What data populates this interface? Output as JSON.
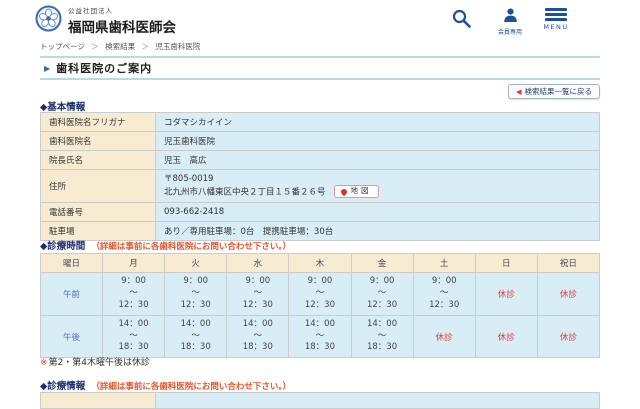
{
  "header": {
    "org_type": "公益社団法人",
    "org_name": "福岡県歯科医師会",
    "member_label": "会員専用",
    "menu_label": "MENU"
  },
  "breadcrumb": {
    "items": [
      "トップページ",
      "検索結果",
      "児玉歯科医院"
    ],
    "separator": "＞"
  },
  "page": {
    "title": "歯科医院のご案内",
    "back_button_label": "検索結果一覧に戻る"
  },
  "basic": {
    "heading": "◆基本情報",
    "rows": [
      {
        "label": "歯科医院名フリガナ",
        "value": "コダマシカイイン"
      },
      {
        "label": "歯科医院名",
        "value": "児玉歯科医院"
      },
      {
        "label": "院長氏名",
        "value": "児玉　高広"
      },
      {
        "label": "住所",
        "postal": "〒805-0019",
        "address": "北九州市八幡東区中央２丁目１５番２６号",
        "map_label": "地図"
      },
      {
        "label": "電話番号",
        "value": "093-662-2418"
      },
      {
        "label": "駐車場",
        "value": "あり／専用駐車場：0台　提携駐車場：30台"
      }
    ]
  },
  "hours": {
    "heading": "◆診療時間",
    "note": "（詳細は事前に各歯科医院にお問い合わせ下さい。）",
    "columns": [
      "曜日",
      "月",
      "火",
      "水",
      "木",
      "金",
      "土",
      "日",
      "祝日"
    ],
    "rows": [
      {
        "label": "午前",
        "cells": [
          "9：00\n～\n12：30",
          "9：00\n～\n12：30",
          "9：00\n～\n12：30",
          "9：00\n～\n12：30",
          "9：00\n～\n12：30",
          "9：00\n～\n12：30",
          "休診",
          "休診"
        ]
      },
      {
        "label": "午後",
        "cells": [
          "14：00\n～\n18：30",
          "14：00\n～\n18：30",
          "14：00\n～\n18：30",
          "14：00\n～\n18：30",
          "14：00\n～\n18：30",
          "休診",
          "休診",
          "休診"
        ]
      }
    ],
    "footnote_marker": "※",
    "footnote": "第2・第4木曜午後は休診"
  },
  "info": {
    "heading": "◆診療情報",
    "note": "（詳細は事前に各歯科医院にお問い合わせ下さい。）",
    "partial_row": {
      "label": "",
      "value": ""
    }
  },
  "colors": {
    "accent_navy": "#1c4f9e",
    "heading_navy": "#1b2f6e",
    "label_beige": "#f7ecd2",
    "value_blue": "#d9edf6",
    "closed_red": "#e03c3c",
    "note_orange": "#e2552c"
  }
}
